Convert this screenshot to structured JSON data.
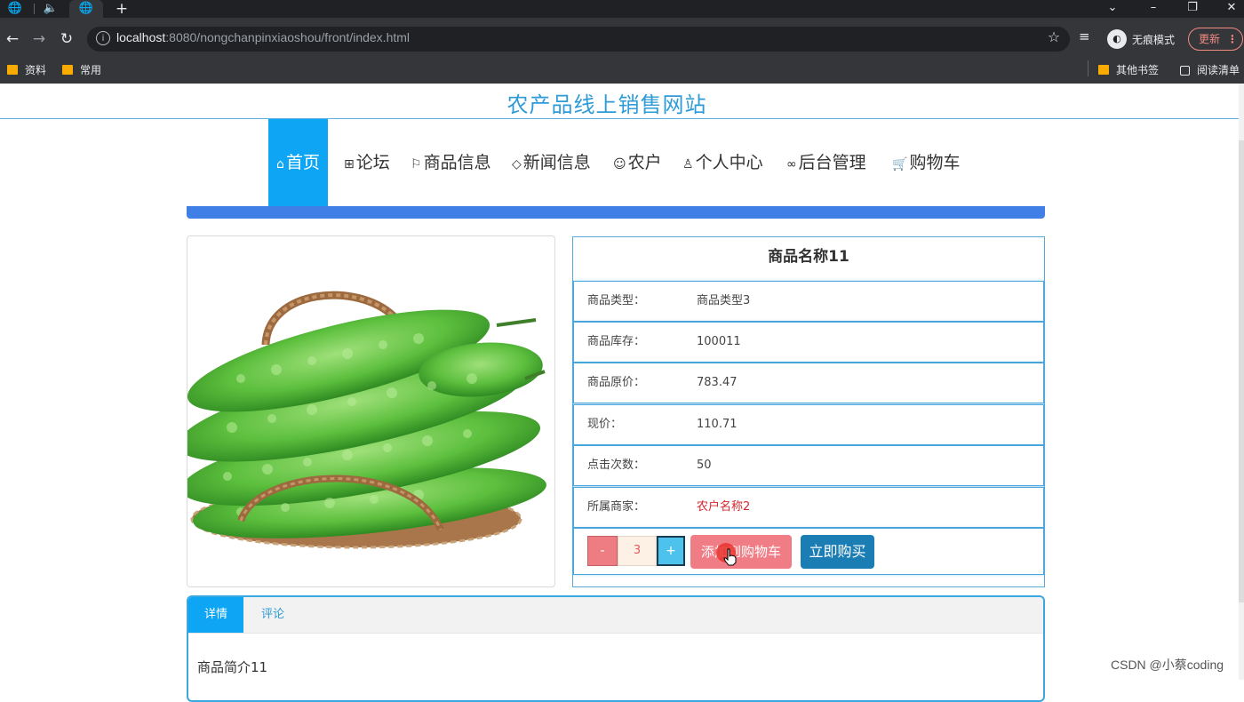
{
  "browser": {
    "address_host": "localhost",
    "address_rest": ":8080/nongchanpinxiaoshou/front/index.html",
    "incognito_label": "无痕模式",
    "update_label": "更新",
    "bookmarks": [
      "资料",
      "常用"
    ],
    "other_bookmarks": "其他书签",
    "reading_list": "阅读清单"
  },
  "site": {
    "title": "农产品线上销售网站",
    "nav": [
      {
        "icon": "home-icon",
        "label": "首页"
      },
      {
        "icon": "forum-icon",
        "label": "论坛"
      },
      {
        "icon": "flag-icon",
        "label": "商品信息"
      },
      {
        "icon": "tag-icon",
        "label": "新闻信息"
      },
      {
        "icon": "farmer-icon",
        "label": "农户"
      },
      {
        "icon": "user-icon",
        "label": "个人中心"
      },
      {
        "icon": "link-icon",
        "label": "后台管理"
      },
      {
        "icon": "cart-icon",
        "label": "购物车"
      }
    ],
    "active_nav": "首页"
  },
  "product": {
    "name": "商品名称11",
    "fields": [
      {
        "label": "商品类型：",
        "value": "商品类型3"
      },
      {
        "label": "商品库存：",
        "value": "100011"
      },
      {
        "label": "商品原价：",
        "value": "783.47"
      },
      {
        "label": "现价：",
        "value": "110.71"
      },
      {
        "label": "点击次数：",
        "value": "50"
      },
      {
        "label": "所属商家：",
        "value": "农户名称2"
      }
    ],
    "quantity": "3",
    "minus_label": "-",
    "plus_label": "+",
    "add_to_cart": "添加到购物车",
    "buy_now": "立即购买"
  },
  "tabs": {
    "detail": "详情",
    "comment": "评论",
    "intro": "商品简介11"
  },
  "watermark": "CSDN @小蔡coding",
  "colors": {
    "primary": "#0ea5f4",
    "title": "#2e9bd6",
    "accent_bar": "#3f7fe6",
    "merchant_red": "#d9262c",
    "buy_button": "#1a7db4",
    "cart_button": "#f07d86"
  }
}
